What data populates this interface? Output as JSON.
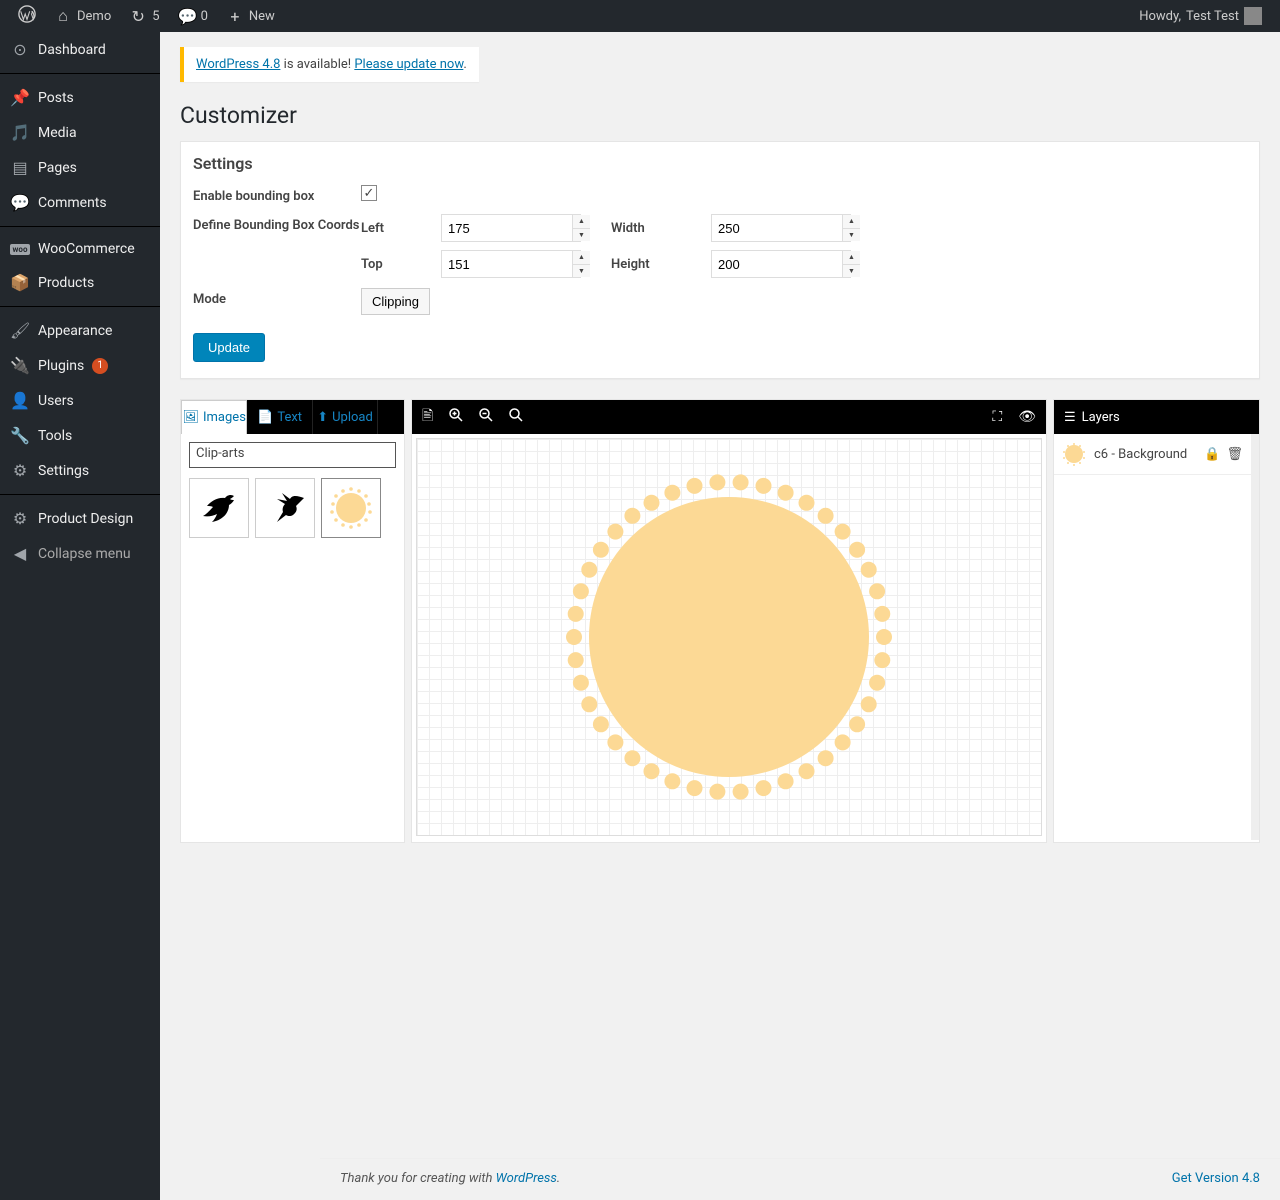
{
  "admin_bar": {
    "site_name": "Demo",
    "updates_count": "5",
    "comments_count": "0",
    "new_label": "New",
    "howdy_prefix": "Howdy, ",
    "user_name": "Test Test"
  },
  "sidebar": {
    "items": [
      {
        "icon": "dashboard",
        "label": "Dashboard"
      },
      {
        "icon": "pin",
        "label": "Posts"
      },
      {
        "icon": "media",
        "label": "Media"
      },
      {
        "icon": "page",
        "label": "Pages"
      },
      {
        "icon": "comment",
        "label": "Comments"
      },
      {
        "icon": "woo",
        "label": "WooCommerce"
      },
      {
        "icon": "box",
        "label": "Products"
      },
      {
        "icon": "brush",
        "label": "Appearance"
      },
      {
        "icon": "plug",
        "label": "Plugins",
        "badge": "1"
      },
      {
        "icon": "user",
        "label": "Users"
      },
      {
        "icon": "wrench",
        "label": "Tools"
      },
      {
        "icon": "sliders",
        "label": "Settings"
      },
      {
        "icon": "gear",
        "label": "Product Design"
      },
      {
        "icon": "collapse",
        "label": "Collapse menu"
      }
    ]
  },
  "notice": {
    "link1": "WordPress 4.8",
    "middle": " is available! ",
    "link2": "Please update now",
    "period": "."
  },
  "page_title": "Customizer",
  "settings": {
    "heading": "Settings",
    "enable_label": "Enable bounding box",
    "enable_checked": true,
    "coords_label": "Define Bounding Box Coords",
    "left_label": "Left",
    "left_value": "175",
    "top_label": "Top",
    "top_value": "151",
    "width_label": "Width",
    "width_value": "250",
    "height_label": "Height",
    "height_value": "200",
    "mode_label": "Mode",
    "mode_button": "Clipping",
    "update_button": "Update"
  },
  "designer": {
    "tabs": {
      "images": "Images",
      "text": "Text",
      "upload": "Upload"
    },
    "category_select": "Clip-arts",
    "cliparts": [
      "bird-silhouette",
      "hummingbird-silhouette",
      "sun-circle"
    ],
    "layers_header": "Layers",
    "layer": {
      "name": "c6 - Background"
    }
  },
  "footer": {
    "thanks_prefix": "Thank you for creating with ",
    "wordpress_link": "WordPress",
    "period": ".",
    "version": "Get Version 4.8"
  },
  "colors": {
    "sun": "#fcd995"
  }
}
